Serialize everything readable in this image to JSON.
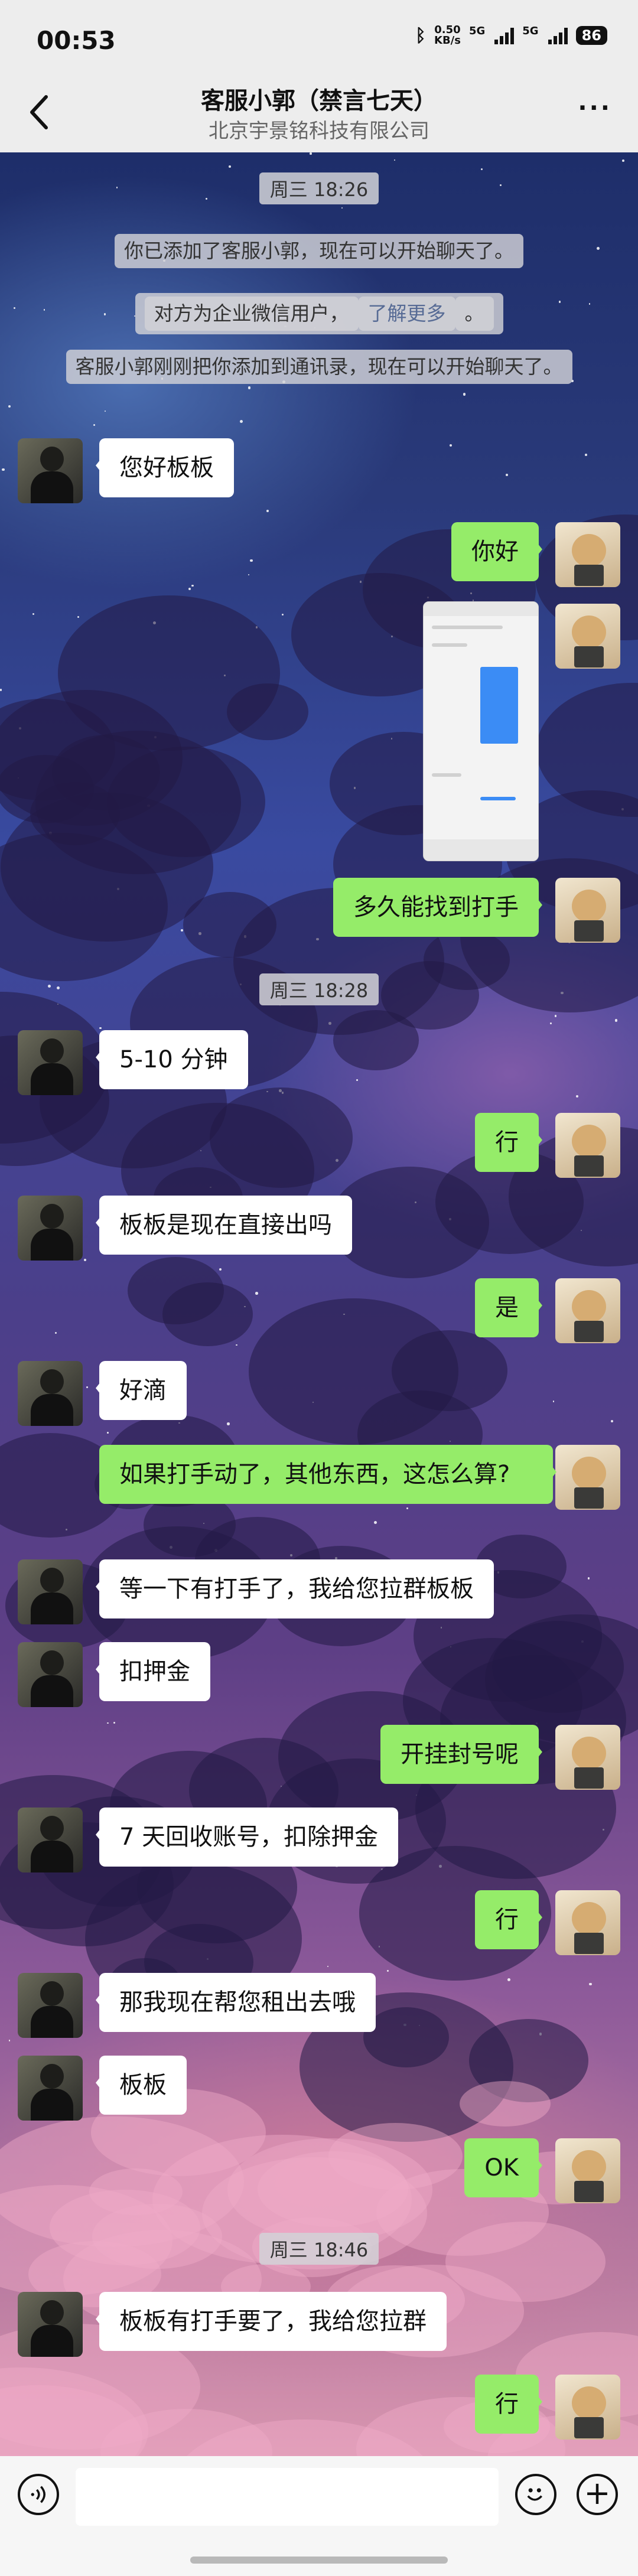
{
  "status_bar": {
    "time": "00:53",
    "net_speed": "0.50",
    "net_unit": "KB/s",
    "sim1": "5G",
    "sim2": "5G",
    "battery": "86",
    "icons": [
      "bluetooth-icon",
      "signal-icon",
      "signal-icon",
      "battery-icon"
    ]
  },
  "header": {
    "title": "客服小郭（禁言七天）",
    "subtitle": "北京宇景铭科技有限公司",
    "back_icon": "back-arrow-icon",
    "more_label": "···"
  },
  "messages": [
    {
      "type": "time",
      "text": "周三 18:26"
    },
    {
      "type": "system",
      "text": "你已添加了客服小郭，现在可以开始聊天了。"
    },
    {
      "type": "system",
      "text": "对方为企业微信用户，",
      "link": "了解更多",
      "suffix": "。"
    },
    {
      "type": "system",
      "text": "客服小郭刚刚把你添加到通讯录，现在可以开始聊天了。"
    },
    {
      "type": "received",
      "text": "您好板板"
    },
    {
      "type": "sent",
      "text": "你好"
    },
    {
      "type": "sent-image",
      "text": ""
    },
    {
      "type": "sent",
      "text": "多久能找到打手"
    },
    {
      "type": "time",
      "text": "周三 18:28"
    },
    {
      "type": "received",
      "text": "5-10 分钟"
    },
    {
      "type": "sent",
      "text": "行"
    },
    {
      "type": "received",
      "text": "板板是现在直接出吗"
    },
    {
      "type": "sent",
      "text": "是"
    },
    {
      "type": "received",
      "text": "好滴"
    },
    {
      "type": "sent",
      "text": "如果打手动了，其他东西，这怎么算?"
    },
    {
      "type": "received",
      "text": "等一下有打手了，我给您拉群板板"
    },
    {
      "type": "received",
      "text": "扣押金"
    },
    {
      "type": "sent",
      "text": "开挂封号呢"
    },
    {
      "type": "received",
      "text": "7 天回收账号，扣除押金"
    },
    {
      "type": "sent",
      "text": "行"
    },
    {
      "type": "received",
      "text": "那我现在帮您租出去哦"
    },
    {
      "type": "received",
      "text": "板板"
    },
    {
      "type": "sent",
      "text": "OK"
    },
    {
      "type": "time",
      "text": "周三 18:46"
    },
    {
      "type": "received",
      "text": "板板有打手要了，我给您拉群"
    },
    {
      "type": "sent",
      "text": "行"
    }
  ],
  "input_bar": {
    "voice_icon": "voice-icon",
    "emoji_icon": "emoji-icon",
    "plus_icon": "plus-icon",
    "plus_label": "+"
  }
}
